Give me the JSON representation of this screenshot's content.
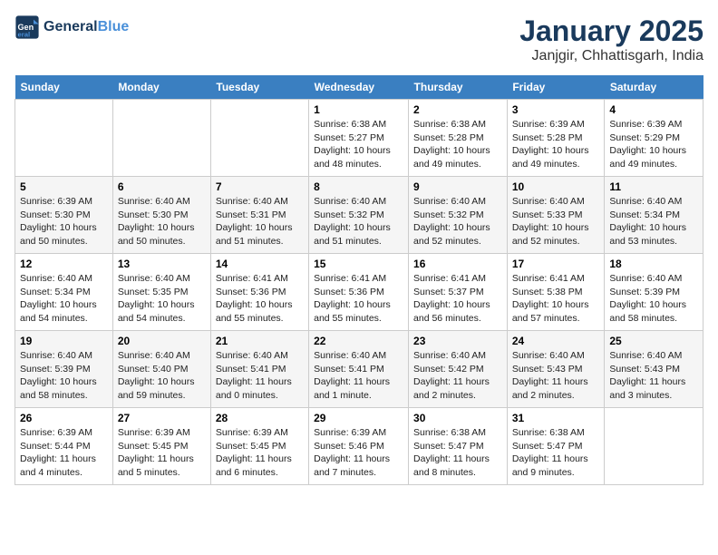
{
  "header": {
    "logo_general": "General",
    "logo_blue": "Blue",
    "month_title": "January 2025",
    "location": "Janjgir, Chhattisgarh, India"
  },
  "days_of_week": [
    "Sunday",
    "Monday",
    "Tuesday",
    "Wednesday",
    "Thursday",
    "Friday",
    "Saturday"
  ],
  "weeks": [
    {
      "days": [
        {
          "num": "",
          "info": ""
        },
        {
          "num": "",
          "info": ""
        },
        {
          "num": "",
          "info": ""
        },
        {
          "num": "1",
          "info": "Sunrise: 6:38 AM\nSunset: 5:27 PM\nDaylight: 10 hours\nand 48 minutes."
        },
        {
          "num": "2",
          "info": "Sunrise: 6:38 AM\nSunset: 5:28 PM\nDaylight: 10 hours\nand 49 minutes."
        },
        {
          "num": "3",
          "info": "Sunrise: 6:39 AM\nSunset: 5:28 PM\nDaylight: 10 hours\nand 49 minutes."
        },
        {
          "num": "4",
          "info": "Sunrise: 6:39 AM\nSunset: 5:29 PM\nDaylight: 10 hours\nand 49 minutes."
        }
      ]
    },
    {
      "days": [
        {
          "num": "5",
          "info": "Sunrise: 6:39 AM\nSunset: 5:30 PM\nDaylight: 10 hours\nand 50 minutes."
        },
        {
          "num": "6",
          "info": "Sunrise: 6:40 AM\nSunset: 5:30 PM\nDaylight: 10 hours\nand 50 minutes."
        },
        {
          "num": "7",
          "info": "Sunrise: 6:40 AM\nSunset: 5:31 PM\nDaylight: 10 hours\nand 51 minutes."
        },
        {
          "num": "8",
          "info": "Sunrise: 6:40 AM\nSunset: 5:32 PM\nDaylight: 10 hours\nand 51 minutes."
        },
        {
          "num": "9",
          "info": "Sunrise: 6:40 AM\nSunset: 5:32 PM\nDaylight: 10 hours\nand 52 minutes."
        },
        {
          "num": "10",
          "info": "Sunrise: 6:40 AM\nSunset: 5:33 PM\nDaylight: 10 hours\nand 52 minutes."
        },
        {
          "num": "11",
          "info": "Sunrise: 6:40 AM\nSunset: 5:34 PM\nDaylight: 10 hours\nand 53 minutes."
        }
      ]
    },
    {
      "days": [
        {
          "num": "12",
          "info": "Sunrise: 6:40 AM\nSunset: 5:34 PM\nDaylight: 10 hours\nand 54 minutes."
        },
        {
          "num": "13",
          "info": "Sunrise: 6:40 AM\nSunset: 5:35 PM\nDaylight: 10 hours\nand 54 minutes."
        },
        {
          "num": "14",
          "info": "Sunrise: 6:41 AM\nSunset: 5:36 PM\nDaylight: 10 hours\nand 55 minutes."
        },
        {
          "num": "15",
          "info": "Sunrise: 6:41 AM\nSunset: 5:36 PM\nDaylight: 10 hours\nand 55 minutes."
        },
        {
          "num": "16",
          "info": "Sunrise: 6:41 AM\nSunset: 5:37 PM\nDaylight: 10 hours\nand 56 minutes."
        },
        {
          "num": "17",
          "info": "Sunrise: 6:41 AM\nSunset: 5:38 PM\nDaylight: 10 hours\nand 57 minutes."
        },
        {
          "num": "18",
          "info": "Sunrise: 6:40 AM\nSunset: 5:39 PM\nDaylight: 10 hours\nand 58 minutes."
        }
      ]
    },
    {
      "days": [
        {
          "num": "19",
          "info": "Sunrise: 6:40 AM\nSunset: 5:39 PM\nDaylight: 10 hours\nand 58 minutes."
        },
        {
          "num": "20",
          "info": "Sunrise: 6:40 AM\nSunset: 5:40 PM\nDaylight: 10 hours\nand 59 minutes."
        },
        {
          "num": "21",
          "info": "Sunrise: 6:40 AM\nSunset: 5:41 PM\nDaylight: 11 hours\nand 0 minutes."
        },
        {
          "num": "22",
          "info": "Sunrise: 6:40 AM\nSunset: 5:41 PM\nDaylight: 11 hours\nand 1 minute."
        },
        {
          "num": "23",
          "info": "Sunrise: 6:40 AM\nSunset: 5:42 PM\nDaylight: 11 hours\nand 2 minutes."
        },
        {
          "num": "24",
          "info": "Sunrise: 6:40 AM\nSunset: 5:43 PM\nDaylight: 11 hours\nand 2 minutes."
        },
        {
          "num": "25",
          "info": "Sunrise: 6:40 AM\nSunset: 5:43 PM\nDaylight: 11 hours\nand 3 minutes."
        }
      ]
    },
    {
      "days": [
        {
          "num": "26",
          "info": "Sunrise: 6:39 AM\nSunset: 5:44 PM\nDaylight: 11 hours\nand 4 minutes."
        },
        {
          "num": "27",
          "info": "Sunrise: 6:39 AM\nSunset: 5:45 PM\nDaylight: 11 hours\nand 5 minutes."
        },
        {
          "num": "28",
          "info": "Sunrise: 6:39 AM\nSunset: 5:45 PM\nDaylight: 11 hours\nand 6 minutes."
        },
        {
          "num": "29",
          "info": "Sunrise: 6:39 AM\nSunset: 5:46 PM\nDaylight: 11 hours\nand 7 minutes."
        },
        {
          "num": "30",
          "info": "Sunrise: 6:38 AM\nSunset: 5:47 PM\nDaylight: 11 hours\nand 8 minutes."
        },
        {
          "num": "31",
          "info": "Sunrise: 6:38 AM\nSunset: 5:47 PM\nDaylight: 11 hours\nand 9 minutes."
        },
        {
          "num": "",
          "info": ""
        }
      ]
    }
  ]
}
